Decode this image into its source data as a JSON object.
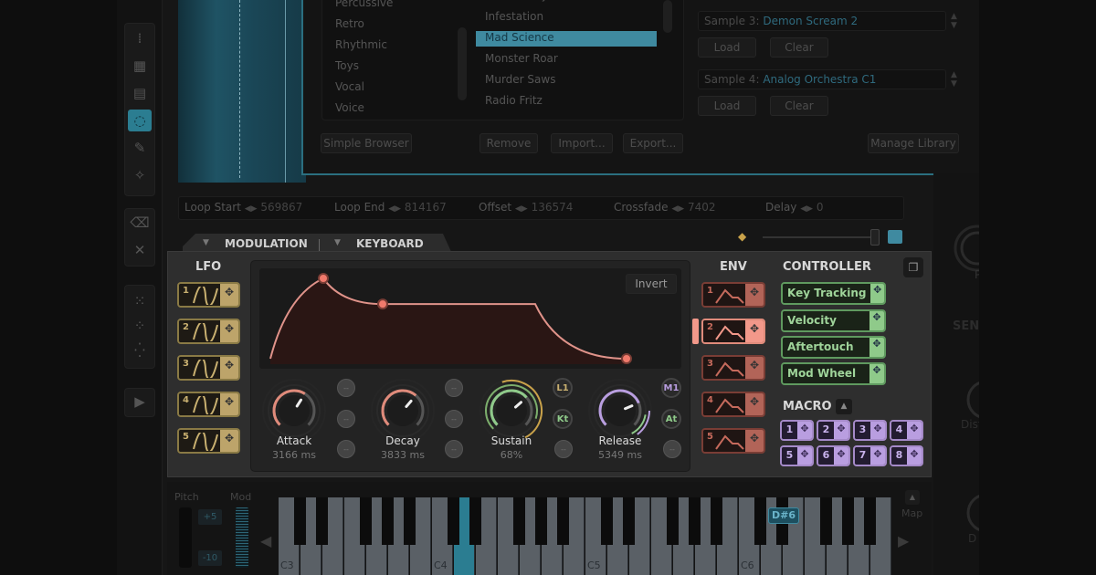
{
  "colors": {
    "accent": "#3f8aa0",
    "lfo": "#bda46a",
    "env": "#b26458",
    "controller": "#8fca8a",
    "macro": "#b99ee0"
  },
  "sidebar": {
    "tools": [
      {
        "icon": "select-column-icon"
      },
      {
        "icon": "select-rect-icon"
      },
      {
        "icon": "select-row-icon"
      },
      {
        "icon": "lasso-icon",
        "selected": true
      },
      {
        "icon": "brush-icon"
      },
      {
        "icon": "magic-wand-icon"
      },
      {
        "icon": "eraser-icon"
      },
      {
        "icon": "delete-selection-icon"
      },
      {
        "icon": "grid-pattern-icon"
      },
      {
        "icon": "grid-diagonal-icon"
      },
      {
        "icon": "grid-scatter-icon"
      },
      {
        "icon": "play-icon"
      }
    ]
  },
  "browser": {
    "categories": [
      "Percussive",
      "Retro",
      "Rhythmic",
      "Toys",
      "Vocal",
      "Voice"
    ],
    "samples": [
      "Human Keys",
      "Infestation",
      "Mad Science",
      "Monster Roar",
      "Murder Saws",
      "Radio Fritz"
    ],
    "selected_sample": "Mad Science",
    "buttons": {
      "simple_browser": "Simple Browser",
      "remove": "Remove",
      "import": "Import...",
      "export": "Export...",
      "manage_library": "Manage Library"
    },
    "slots": [
      {
        "label": "Sample 3:",
        "name": "Demon Scream 2",
        "load": "Load",
        "clear": "Clear"
      },
      {
        "label": "Sample 4:",
        "name": "Analog Orchestra C1",
        "load": "Load",
        "clear": "Clear"
      }
    ]
  },
  "loop": {
    "items": [
      {
        "label": "Loop Start",
        "value": "569867"
      },
      {
        "label": "Loop End",
        "value": "814167"
      },
      {
        "label": "Offset",
        "value": "136574"
      },
      {
        "label": "Crossfade",
        "value": "7402"
      },
      {
        "label": "Delay",
        "value": "0"
      }
    ]
  },
  "tabs": {
    "modulation": "MODULATION",
    "keyboard": "KEYBOARD"
  },
  "modulation": {
    "lfo_title": "LFO",
    "lfos": [
      "1",
      "2",
      "3",
      "4",
      "5"
    ],
    "env_title": "ENV",
    "envs": [
      "1",
      "2",
      "3",
      "4",
      "5"
    ],
    "selected_env": "2",
    "invert": "Invert",
    "envelope_shape": {
      "attack_peak": 1.0,
      "sustain_level": 0.68
    },
    "knobs": [
      {
        "label": "Attack",
        "value": "3166 ms",
        "fraction": 0.62,
        "color": "#e08b7b"
      },
      {
        "label": "Decay",
        "value": "3833 ms",
        "fraction": 0.65,
        "color": "#e08b7b"
      },
      {
        "label": "Sustain",
        "value": "68%",
        "fraction": 0.68,
        "color": "#8fca8a"
      },
      {
        "label": "Release",
        "value": "5349 ms",
        "fraction": 0.75,
        "color": "#b99ee0"
      }
    ],
    "mod_buttons": {
      "l1": "L1",
      "kt": "Kt",
      "m1": "M1",
      "at": "At",
      "empty": "--"
    },
    "controller_title": "CONTROLLER",
    "controllers": [
      "Key Tracking",
      "Velocity",
      "Aftertouch",
      "Mod Wheel"
    ],
    "macro_title": "MACRO",
    "macros": [
      "1",
      "2",
      "3",
      "4",
      "5",
      "6",
      "7",
      "8"
    ]
  },
  "keyboard": {
    "pitch_label": "Pitch",
    "mod_label": "Mod",
    "pitch_up": "+5",
    "pitch_down": "-10",
    "octave_labels": [
      "C3",
      "C4",
      "C5",
      "C6"
    ],
    "pressed_key": "D4",
    "hover_note": "D#6",
    "map_label": "Map"
  },
  "right_panel": {
    "labels": [
      "P",
      "SEN",
      "Dist",
      "D"
    ]
  }
}
